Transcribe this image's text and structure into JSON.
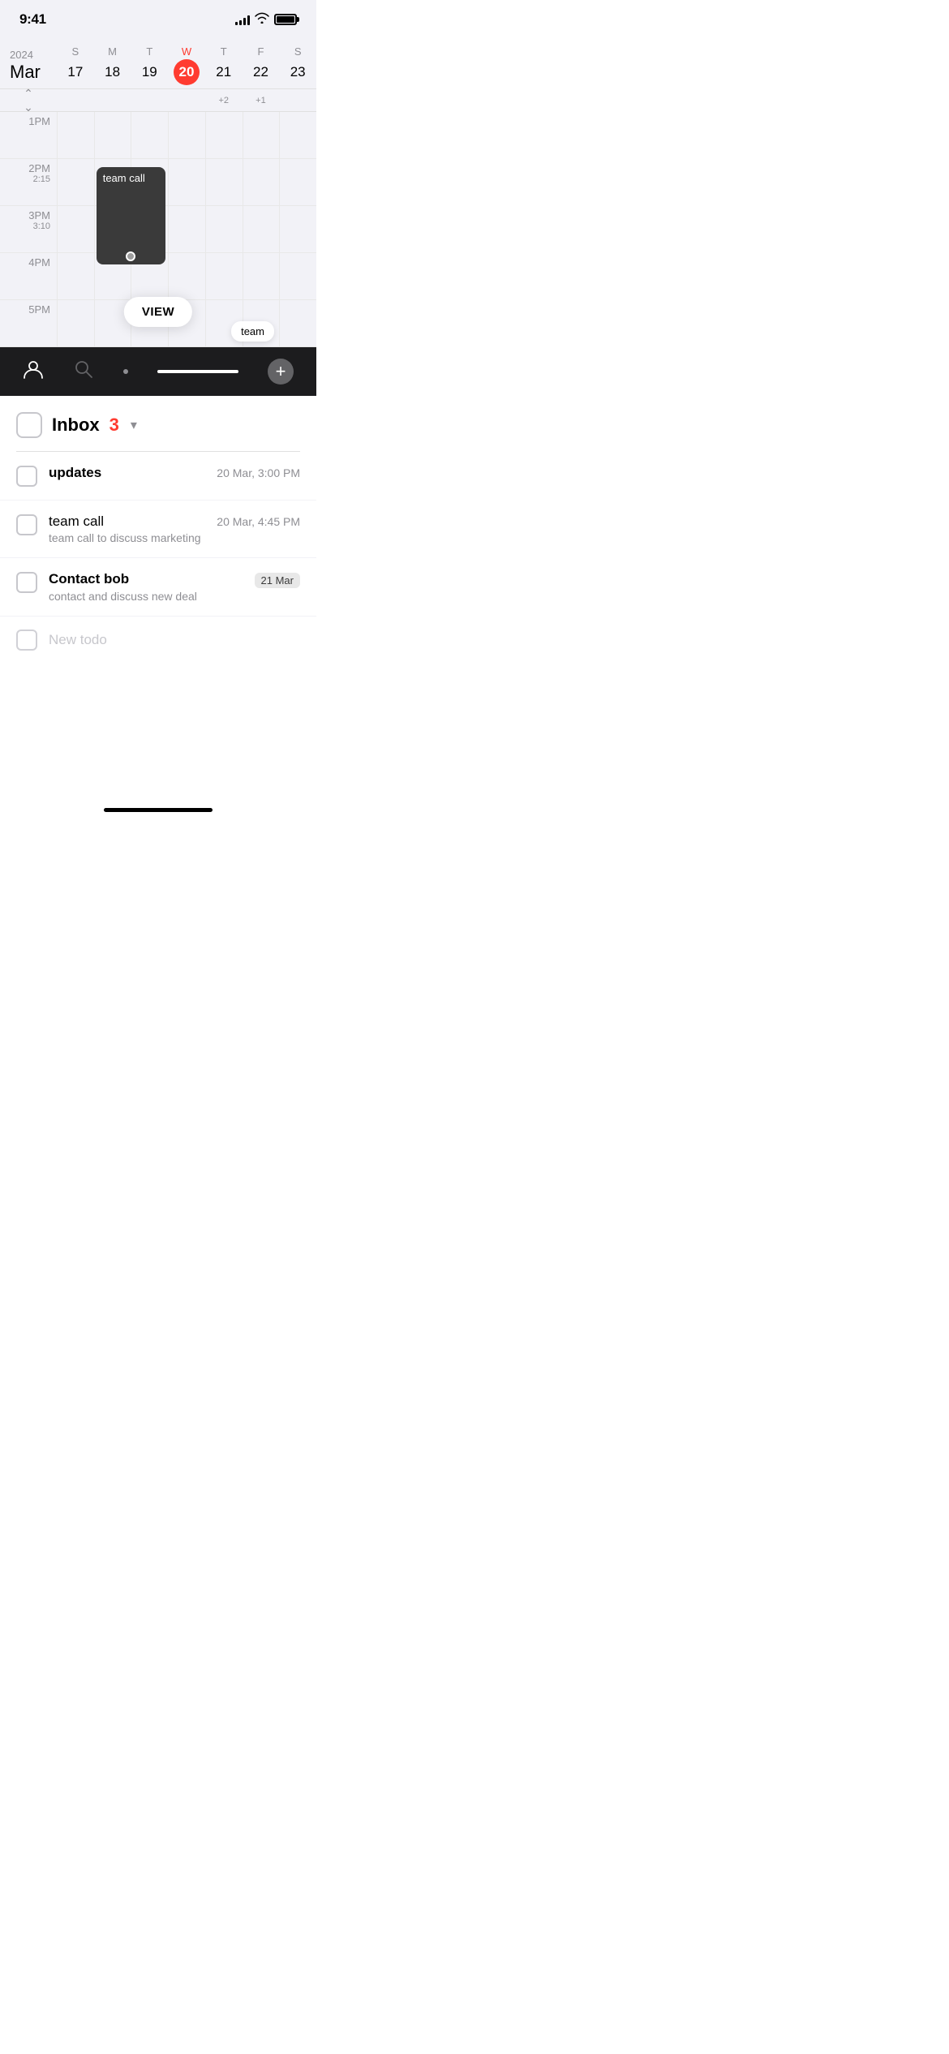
{
  "statusBar": {
    "time": "9:41",
    "signalBars": [
      4,
      6,
      8,
      10,
      12
    ],
    "battery": "full"
  },
  "calendar": {
    "year": "2024",
    "month": "Mar",
    "days": [
      {
        "letter": "S",
        "number": "17",
        "today": false
      },
      {
        "letter": "M",
        "number": "18",
        "today": false
      },
      {
        "letter": "T",
        "number": "19",
        "today": false
      },
      {
        "letter": "W",
        "number": "20",
        "today": true
      },
      {
        "letter": "T",
        "number": "21",
        "today": false
      },
      {
        "letter": "F",
        "number": "22",
        "today": false
      },
      {
        "letter": "S",
        "number": "23",
        "today": false
      }
    ],
    "indicators": {
      "thu": "+2",
      "fri": "+1"
    },
    "timeSlots": [
      {
        "label": "1PM",
        "sublabel": ""
      },
      {
        "label": "2PM",
        "sublabel": "2:15"
      },
      {
        "label": "3PM",
        "sublabel": "3:10"
      },
      {
        "label": "4PM",
        "sublabel": ""
      },
      {
        "label": "5PM",
        "sublabel": ""
      }
    ],
    "event": {
      "title": "team call",
      "dayIndex": 1
    },
    "viewPopup": "VIEW",
    "teamBubble": "team"
  },
  "tabBar": {
    "personIcon": "👤",
    "searchIcon": "🔍",
    "addIcon": "+"
  },
  "inbox": {
    "title": "Inbox",
    "count": "3",
    "chevron": "▾"
  },
  "todos": [
    {
      "id": "updates",
      "title": "updates",
      "bold": true,
      "subtitle": "",
      "date": "20 Mar, 3:00 PM",
      "dateBadge": false
    },
    {
      "id": "team-call",
      "title": "team call",
      "bold": false,
      "subtitle": "team call to discuss marketing",
      "date": "20 Mar, 4:45 PM",
      "dateBadge": false
    },
    {
      "id": "contact-bob",
      "title": "Contact bob",
      "bold": true,
      "subtitle": "contact and discuss new deal",
      "date": "21 Mar",
      "dateBadge": true
    }
  ],
  "newTodoPlaceholder": "New todo",
  "homeIndicator": "─"
}
